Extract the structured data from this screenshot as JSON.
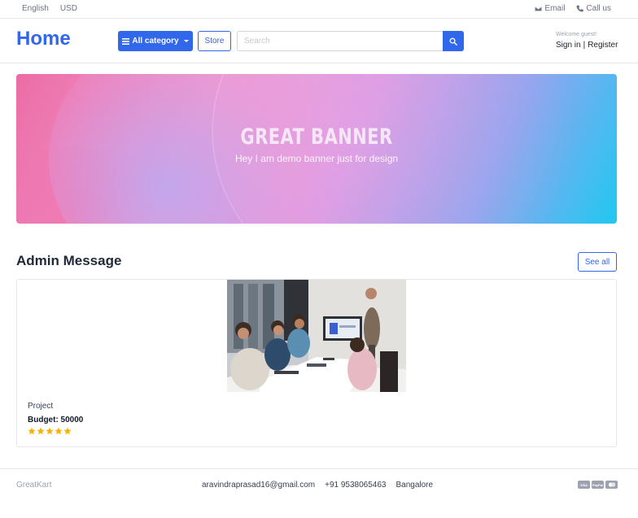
{
  "topbar": {
    "language": "English",
    "currency": "USD",
    "email_label": "Email",
    "call_label": "Call us"
  },
  "header": {
    "brand": "Home",
    "category_button": "All category",
    "store_button": "Store",
    "search_placeholder": "Search",
    "welcome": "Welcome guest!",
    "sign_in": "Sign in",
    "separator": "|",
    "register": "Register"
  },
  "banner": {
    "title": "GREAT BANNER",
    "subtitle": "Hey I am demo banner just for design"
  },
  "section": {
    "title": "Admin Message",
    "see_all": "See all"
  },
  "card": {
    "title": "Project",
    "budget": "Budget: 50000",
    "rating": 5,
    "star_color": "#f5b301"
  },
  "footer": {
    "brand": "GreatKart",
    "email": "aravindraprasad16@gmail.com",
    "phone": "+91 9538065463",
    "city": "Bangalore",
    "payment_icons": [
      "visa-icon",
      "paypal-icon",
      "mastercard-icon"
    ]
  },
  "colors": {
    "accent": "#3167eb"
  }
}
